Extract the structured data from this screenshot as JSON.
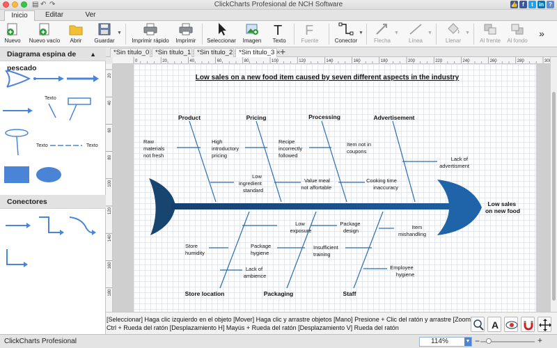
{
  "window": {
    "title": "ClickCharts Profesional de NCH Software"
  },
  "ribbon_tabs": [
    "Inicio",
    "Editar",
    "Ver"
  ],
  "toolbar": {
    "nuevo": "Nuevo",
    "nuevo_vacio": "Nuevo vacío",
    "abrir": "Abrir",
    "guardar": "Guardar",
    "imprimir_rapido": "Imprimir rápido",
    "imprimir": "Imprimir",
    "seleccionar": "Seleccionar",
    "imagen": "Imagen",
    "texto": "Texto",
    "fuente": "Fuente",
    "conector": "Conector",
    "flecha": "Flecha",
    "linea": "Línea",
    "llenar": "Llenar",
    "al_frente": "Al frente",
    "al_fondo": "Al fondo",
    "more": "»"
  },
  "left_panel": {
    "section1_title": "Diagrama espina de pescado",
    "section2_title": "Conectores",
    "shape_text_1": "Texto",
    "shape_text_2": "Texto",
    "shape_text_3": "Texto"
  },
  "doc_tabs": [
    "*Sin título_0",
    "*Sin título_1",
    "*Sin título_2",
    "*Sin título_3"
  ],
  "ruler": {
    "h_ticks": [
      "0",
      "20",
      "40",
      "60",
      "80",
      "100",
      "120",
      "140",
      "160",
      "180",
      "200",
      "220",
      "240",
      "260",
      "280",
      "300"
    ],
    "v_ticks": [
      "20",
      "40",
      "60",
      "80",
      "100",
      "120",
      "140",
      "160",
      "180"
    ]
  },
  "diagram": {
    "title": "Low sales on a new food item caused by seven different aspects in the industry",
    "effect": [
      "Low sales",
      "on new food"
    ],
    "categories": {
      "product": "Product",
      "pricing": "Pricing",
      "processing": "Processing",
      "advertisement": "Advertisement",
      "store_location": "Store location",
      "packaging": "Packaging",
      "staff": "Staff"
    },
    "causes": {
      "raw": [
        "Raw",
        "materials",
        "not fresh"
      ],
      "high_intro": [
        "High",
        "introductory",
        "pricing"
      ],
      "recipe": [
        "Recipe",
        "incorrectly",
        "followed"
      ],
      "item_coupons": [
        "Item not in",
        "coupons"
      ],
      "lack_adv": [
        "Lack of",
        "advertisment"
      ],
      "low_ingredient": [
        "Low",
        "ingredient",
        "standard"
      ],
      "value_meal": [
        "Value meal",
        "not affortable"
      ],
      "cooking": [
        "Cooking time",
        "inaccuracy"
      ],
      "low_exposure": [
        "Low",
        "exposure"
      ],
      "package_design": [
        "Package",
        "design"
      ],
      "item_mish": [
        "Item",
        "mishandling"
      ],
      "store_hum": [
        "Store",
        "humidity"
      ],
      "pack_hyg": [
        "Package",
        "hygiene"
      ],
      "insuff": [
        "Insufficient",
        "training"
      ],
      "lack_amb": [
        "Lack of",
        "ambience"
      ],
      "employee": [
        "Employee",
        "hygiene"
      ]
    }
  },
  "status": {
    "line1": "[Seleccionar] Haga clic izquierdo en el objeto [Mover] Haga clic y arrastre objetos [Mano] Presione + Clic del ratón y arrastre [Zoom]",
    "line2": "Ctrl + Rueda del ratón [Desplazamiento H] Mayús + Rueda del ratón [Desplazamiento V] Rueda del ratón"
  },
  "bottom": {
    "app_name": "ClickCharts Profesional",
    "zoom": "114%",
    "zoom_level": 0.15
  },
  "colors": {
    "fish": "#1b4f86",
    "fish_light": "#2a6cb0",
    "shape_blue": "#4a84d6",
    "grid": "#e3e6ea"
  }
}
